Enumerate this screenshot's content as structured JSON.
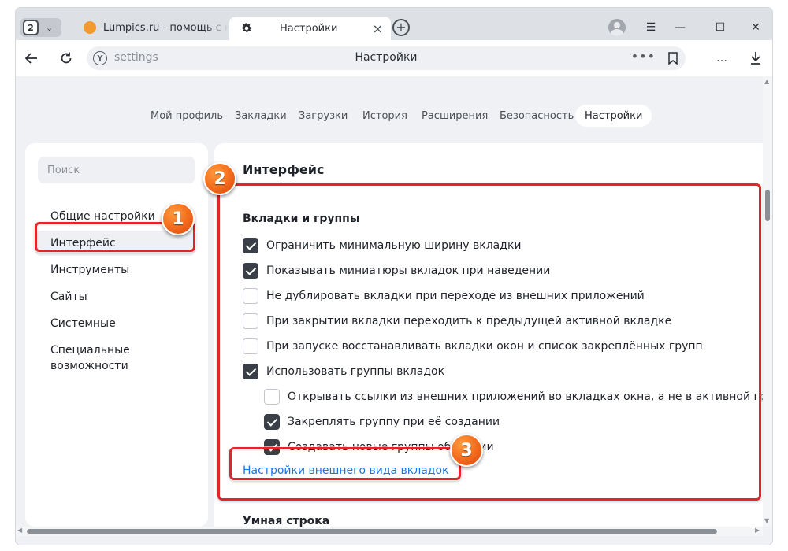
{
  "window": {
    "tab_count": "2",
    "tabs": [
      {
        "title": "Lumpics.ru - помощь с компьютером"
      },
      {
        "title": "Настройки"
      }
    ]
  },
  "toolbar": {
    "url": "settings",
    "page_title": "Настройки",
    "more_dots": "•••"
  },
  "nav_tabs": [
    {
      "label": "Мой профиль"
    },
    {
      "label": "Закладки"
    },
    {
      "label": "Загрузки"
    },
    {
      "label": "История"
    },
    {
      "label": "Расширения"
    },
    {
      "label": "Безопасность"
    },
    {
      "label": "Настройки"
    }
  ],
  "sidebar": {
    "search_placeholder": "Поиск",
    "items": [
      {
        "label": "Общие настройки"
      },
      {
        "label": "Интерфейс"
      },
      {
        "label": "Инструменты"
      },
      {
        "label": "Сайты"
      },
      {
        "label": "Системные"
      },
      {
        "label": "Специальные возможности"
      }
    ]
  },
  "main": {
    "title": "Интерфейс",
    "section_title": "Вкладки и группы",
    "options": [
      {
        "label": "Ограничить минимальную ширину вкладки",
        "checked": true
      },
      {
        "label": "Показывать миниатюры вкладок при наведении",
        "checked": true
      },
      {
        "label": "Не дублировать вкладки при переходе из внешних приложений",
        "checked": false
      },
      {
        "label": "При закрытии вкладки переходить к предыдущей активной вкладке",
        "checked": false
      },
      {
        "label": "При запуске восстанавливать вкладки окон и список закреплённых групп",
        "checked": false
      },
      {
        "label": "Использовать группы вкладок",
        "checked": true
      },
      {
        "label": "Открывать ссылки из внешних приложений во вкладках окна, а не в активной группе",
        "checked": false
      },
      {
        "label": "Закреплять группу при её создании",
        "checked": true
      },
      {
        "label": "Создавать новые группы облаками",
        "checked": true
      }
    ],
    "link": "Настройки внешнего вида вкладок",
    "next_section_title": "Умная строка"
  },
  "annotations": {
    "color": "#e3252a",
    "badges": [
      "1",
      "2",
      "3"
    ]
  }
}
